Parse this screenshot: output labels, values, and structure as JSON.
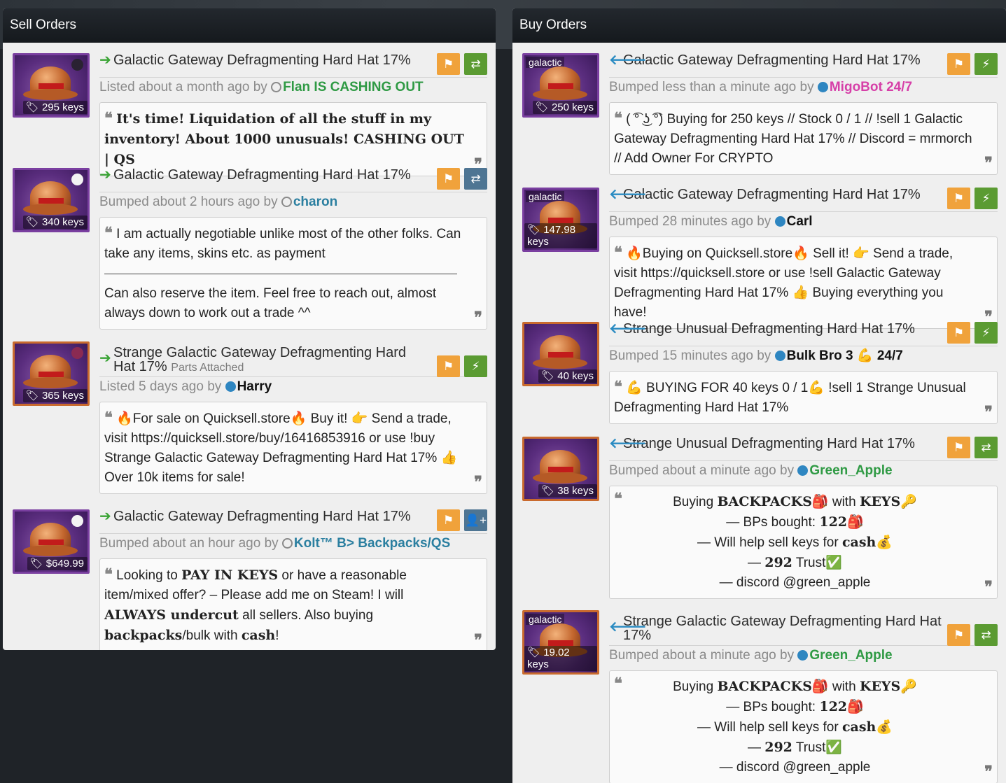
{
  "sell": {
    "title": "Sell Orders",
    "listings": [
      {
        "name": "Galactic Gateway Defragmenting Hard Hat 17%",
        "price": "295 keys",
        "meta_prefix": "Listed about a month ago by",
        "user": "Flan IS CASHING OUT",
        "quote1": "It's time! Liquidation of all the stuff in my inventory! About 1000 unusuals! CASHING OUT | QS"
      },
      {
        "name": "Galactic Gateway Defragmenting Hard Hat 17%",
        "price": "340 keys",
        "meta_prefix": "Bumped about 2 hours ago by",
        "user": "charon",
        "quote1": "I am actually negotiable unlike most of the other folks. Can take any items, skins etc. as payment",
        "quote2": "Can also reserve the item. Feel free to reach out, almost always down to work out a trade ^^"
      },
      {
        "name": "Strange Galactic Gateway Defragmenting Hard Hat 17%",
        "parts": "Parts Attached",
        "price": "365 keys",
        "meta_prefix": "Listed 5 days ago by",
        "user": "Harry",
        "quote1": "🔥For sale on Quicksell.store🔥 Buy it! 👉 Send a trade, visit https://quicksell.store/buy/16416853916 or use !buy Strange Galactic Gateway Defragmenting Hard Hat 17% 👍 Over 10k items for sale!"
      },
      {
        "name": "Galactic Gateway Defragmenting Hard Hat 17%",
        "price": "$649.99",
        "meta_prefix": "Bumped about an hour ago by",
        "user": "Kolt™ B> Backpacks/QS",
        "q_a": "Looking to ",
        "q_b": "PAY IN KEYS",
        "q_c": " or have a reasonable item/mixed offer? – Please add me on Steam! I will ",
        "q_d": "ALWAYS undercut",
        "q_e": " all sellers. Also buying ",
        "q_f": "backpacks",
        "q_g": "/bulk with ",
        "q_h": "cash",
        "q_i": "!"
      }
    ]
  },
  "buy": {
    "title": "Buy Orders",
    "listings": [
      {
        "name": "Galactic Gateway Defragmenting Hard Hat 17%",
        "tag": "galactic",
        "price": "250 keys",
        "meta_prefix": "Bumped less than a minute ago by",
        "user": "MigoBot 24/7",
        "quote1": "( ͡° ͜ʖ ͡°) Buying for 250 keys // Stock 0 / 1 // !sell 1 Galactic Gateway Defragmenting Hard Hat 17% // Discord = mrmorch // Add Owner For CRYPTO"
      },
      {
        "name": "Galactic Gateway Defragmenting Hard Hat 17%",
        "tag": "galactic",
        "price": "147.98 keys",
        "meta_prefix": "Bumped 28 minutes ago by",
        "user": "Carl",
        "quote1": "🔥Buying on Quicksell.store🔥 Sell it! 👉 Send a trade, visit https://quicksell.store or use !sell Galactic Gateway Defragmenting Hard Hat 17% 👍 Buying everything you have!"
      },
      {
        "name": "Strange Unusual Defragmenting Hard Hat 17%",
        "price": "40 keys",
        "meta_prefix": "Bumped 15 minutes ago by",
        "user": "Bulk Bro 3 💪 24/7",
        "quote1": "💪 BUYING FOR 40 keys 0 / 1💪 !sell 1 Strange Unusual Defragmenting Hard Hat 17%"
      },
      {
        "name": "Strange Unusual Defragmenting Hard Hat 17%",
        "price": "38 keys",
        "meta_prefix": "Bumped about a minute ago by",
        "user": "Green_Apple",
        "lines": {
          "l1a": "Buying ",
          "l1b": "BACKPACKS",
          "l1c": "🎒 with ",
          "l1d": "KEYS",
          "l1e": "🔑",
          "l2a": "— BPs bought: ",
          "l2b": "122",
          "l2c": "🎒",
          "l3a": "— Will help sell keys for ",
          "l3b": "cash",
          "l3c": "💰",
          "l4a": "— ",
          "l4b": "292",
          "l4c": " Trust✅",
          "l5": "— discord @green_apple"
        }
      },
      {
        "name": "Strange Galactic Gateway Defragmenting Hard Hat 17%",
        "tag": "galactic",
        "price": "19.02 keys",
        "meta_prefix": "Bumped about a minute ago by",
        "user": "Green_Apple",
        "lines": {
          "l1a": "Buying ",
          "l1b": "BACKPACKS",
          "l1c": "🎒 with ",
          "l1d": "KEYS",
          "l1e": "🔑",
          "l2a": "— BPs bought: ",
          "l2b": "122",
          "l2c": "🎒",
          "l3a": "— Will help sell keys for ",
          "l3b": "cash",
          "l3c": "💰",
          "l4a": "— ",
          "l4b": "292",
          "l4c": " Trust✅",
          "l5": "— discord @green_apple"
        }
      }
    ]
  },
  "icons": {
    "flag": "flag-icon",
    "swap": "swap-icon",
    "lightning": "lightning-icon",
    "add_friend": "add-friend-icon",
    "tag": "price-tag-icon"
  },
  "colors": {
    "orange_button": "#f0a23b",
    "green_button": "#5b9b32",
    "slate_button": "#4e7593",
    "sell_arrow": "#3aa335",
    "buy_arrow": "#2a8bc2"
  }
}
